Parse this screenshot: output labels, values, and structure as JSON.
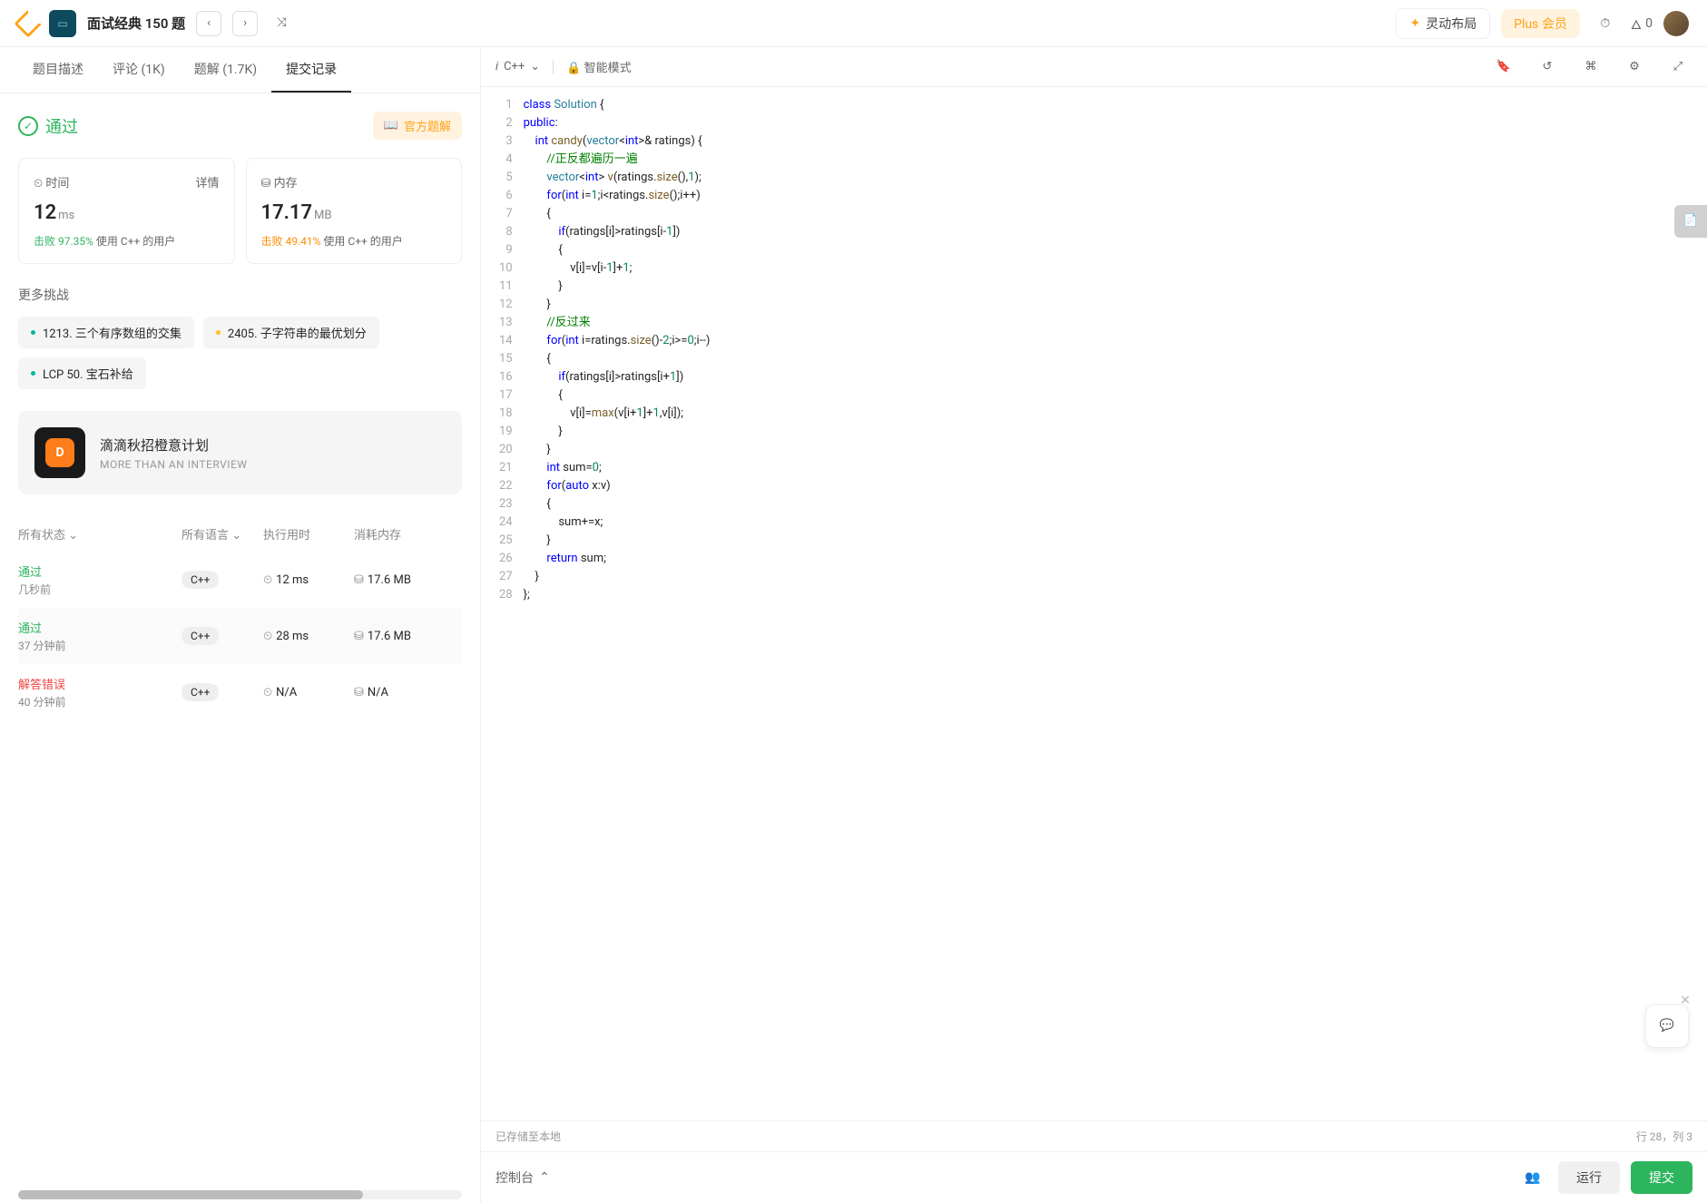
{
  "header": {
    "title": "面试经典 150 题",
    "layout_btn": "灵动布局",
    "plus_btn": "Plus 会员",
    "streak": "0"
  },
  "tabs": {
    "desc": "题目描述",
    "comments": "评论 (1K)",
    "solutions": "题解 (1.7K)",
    "submissions": "提交记录"
  },
  "result": {
    "status": "通过",
    "official": "官方题解",
    "time_card": {
      "label": "时间",
      "detail": "详情",
      "value": "12",
      "unit": "ms",
      "beat_label": "击败",
      "beat_pct": "97.35%",
      "beat_suffix": "使用 C++ 的用户"
    },
    "mem_card": {
      "label": "内存",
      "value": "17.17",
      "unit": "MB",
      "beat_label": "击败",
      "beat_pct": "49.41%",
      "beat_suffix": "使用 C++ 的用户"
    }
  },
  "challenges": {
    "title": "更多挑战",
    "items": [
      "1213. 三个有序数组的交集",
      "2405. 子字符串的最优划分",
      "LCP 50. 宝石补给"
    ]
  },
  "promo": {
    "title": "滴滴秋招橙意计划",
    "sub": "MORE THAN AN INTERVIEW"
  },
  "subtable": {
    "head": {
      "status": "所有状态",
      "lang": "所有语言",
      "time": "执行用时",
      "mem": "消耗内存"
    },
    "rows": [
      {
        "status": "通过",
        "status_class": "pass",
        "when": "几秒前",
        "lang": "C++",
        "time": "12 ms",
        "mem": "17.6 MB"
      },
      {
        "status": "通过",
        "status_class": "pass",
        "when": "37 分钟前",
        "lang": "C++",
        "time": "28 ms",
        "mem": "17.6 MB"
      },
      {
        "status": "解答错误",
        "status_class": "err",
        "when": "40 分钟前",
        "lang": "C++",
        "time": "N/A",
        "mem": "N/A"
      }
    ]
  },
  "editor": {
    "lang": "C++",
    "mode": "智能模式",
    "saved": "已存储至本地",
    "cursor": "行 28，列 3",
    "console": "控制台",
    "run": "运行",
    "submit": "提交"
  }
}
